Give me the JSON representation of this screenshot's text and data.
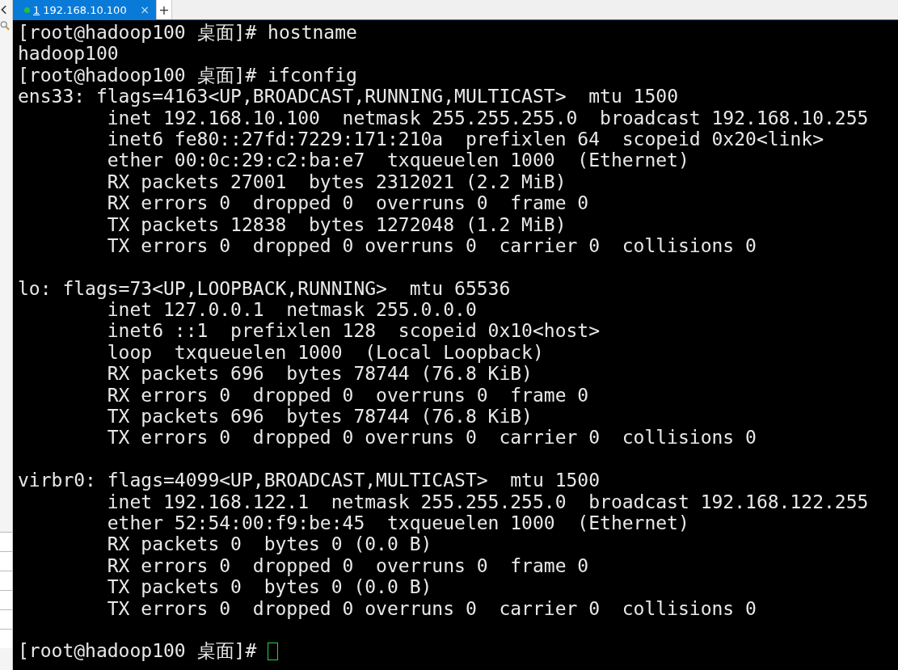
{
  "tabs": [
    {
      "number": "1",
      "title": "192.168.10.100",
      "close": "×",
      "selected": true,
      "connected": true
    }
  ],
  "new_tab": "+",
  "terminal": {
    "blocks": [
      [
        {
          "kind": "prompt",
          "prompt": "[root@hadoop100 桌面]#",
          "command": "hostname"
        },
        {
          "kind": "output",
          "text": "hadoop100",
          "indented": false
        },
        {
          "kind": "prompt",
          "prompt": "[root@hadoop100 桌面]#",
          "command": "ifconfig"
        },
        {
          "kind": "output",
          "text": "ens33: flags=4163<UP,BROADCAST,RUNNING,MULTICAST>  mtu 1500",
          "indented": false
        },
        {
          "kind": "output",
          "text": "inet 192.168.10.100  netmask 255.255.255.0  broadcast 192.168.10.255",
          "indented": true
        },
        {
          "kind": "output",
          "text": "inet6 fe80::27fd:7229:171:210a  prefixlen 64  scopeid 0x20<link>",
          "indented": true
        },
        {
          "kind": "output",
          "text": "ether 00:0c:29:c2:ba:e7  txqueuelen 1000  (Ethernet)",
          "indented": true
        },
        {
          "kind": "output",
          "text": "RX packets 27001  bytes 2312021 (2.2 MiB)",
          "indented": true
        },
        {
          "kind": "output",
          "text": "RX errors 0  dropped 0  overruns 0  frame 0",
          "indented": true
        },
        {
          "kind": "output",
          "text": "TX packets 12838  bytes 1272048 (1.2 MiB)",
          "indented": true
        },
        {
          "kind": "output",
          "text": "TX errors 0  dropped 0 overruns 0  carrier 0  collisions 0",
          "indented": true
        }
      ],
      [
        {
          "kind": "output",
          "text": "lo: flags=73<UP,LOOPBACK,RUNNING>  mtu 65536",
          "indented": false
        },
        {
          "kind": "output",
          "text": "inet 127.0.0.1  netmask 255.0.0.0",
          "indented": true
        },
        {
          "kind": "output",
          "text": "inet6 ::1  prefixlen 128  scopeid 0x10<host>",
          "indented": true
        },
        {
          "kind": "output",
          "text": "loop  txqueuelen 1000  (Local Loopback)",
          "indented": true
        },
        {
          "kind": "output",
          "text": "RX packets 696  bytes 78744 (76.8 KiB)",
          "indented": true
        },
        {
          "kind": "output",
          "text": "RX errors 0  dropped 0  overruns 0  frame 0",
          "indented": true
        },
        {
          "kind": "output",
          "text": "TX packets 696  bytes 78744 (76.8 KiB)",
          "indented": true
        },
        {
          "kind": "output",
          "text": "TX errors 0  dropped 0 overruns 0  carrier 0  collisions 0",
          "indented": true
        }
      ],
      [
        {
          "kind": "output",
          "text": "virbr0: flags=4099<UP,BROADCAST,MULTICAST>  mtu 1500",
          "indented": false
        },
        {
          "kind": "output",
          "text": "inet 192.168.122.1  netmask 255.255.255.0  broadcast 192.168.122.255",
          "indented": true
        },
        {
          "kind": "output",
          "text": "ether 52:54:00:f9:be:45  txqueuelen 1000  (Ethernet)",
          "indented": true
        },
        {
          "kind": "output",
          "text": "RX packets 0  bytes 0 (0.0 B)",
          "indented": true
        },
        {
          "kind": "output",
          "text": "RX errors 0  dropped 0  overruns 0  frame 0",
          "indented": true
        },
        {
          "kind": "output",
          "text": "TX packets 0  bytes 0 (0.0 B)",
          "indented": true
        },
        {
          "kind": "output",
          "text": "TX errors 0  dropped 0 overruns 0  carrier 0  collisions 0",
          "indented": true
        }
      ],
      [
        {
          "kind": "prompt",
          "prompt": "[root@hadoop100 桌面]#",
          "cursor": true
        }
      ]
    ]
  }
}
